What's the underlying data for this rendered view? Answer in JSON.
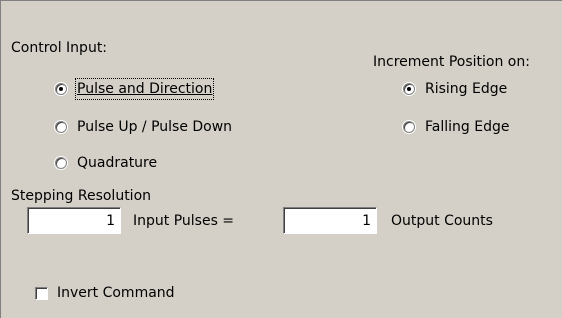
{
  "control_input": {
    "label": "Control Input:",
    "options": [
      {
        "label": "Pulse and Direction",
        "selected": true
      },
      {
        "label": "Pulse Up / Pulse Down",
        "selected": false
      },
      {
        "label": "Quadrature",
        "selected": false
      }
    ]
  },
  "increment_position": {
    "label": "Increment Position on:",
    "options": [
      {
        "label": "Rising Edge",
        "selected": true
      },
      {
        "label": "Falling Edge",
        "selected": false
      }
    ]
  },
  "stepping_resolution": {
    "label": "Stepping Resolution",
    "input_pulses_value": "1",
    "input_pulses_label": "Input Pulses =",
    "output_counts_value": "1",
    "output_counts_label": "Output Counts"
  },
  "invert_command": {
    "label": "Invert Command",
    "checked": false
  }
}
